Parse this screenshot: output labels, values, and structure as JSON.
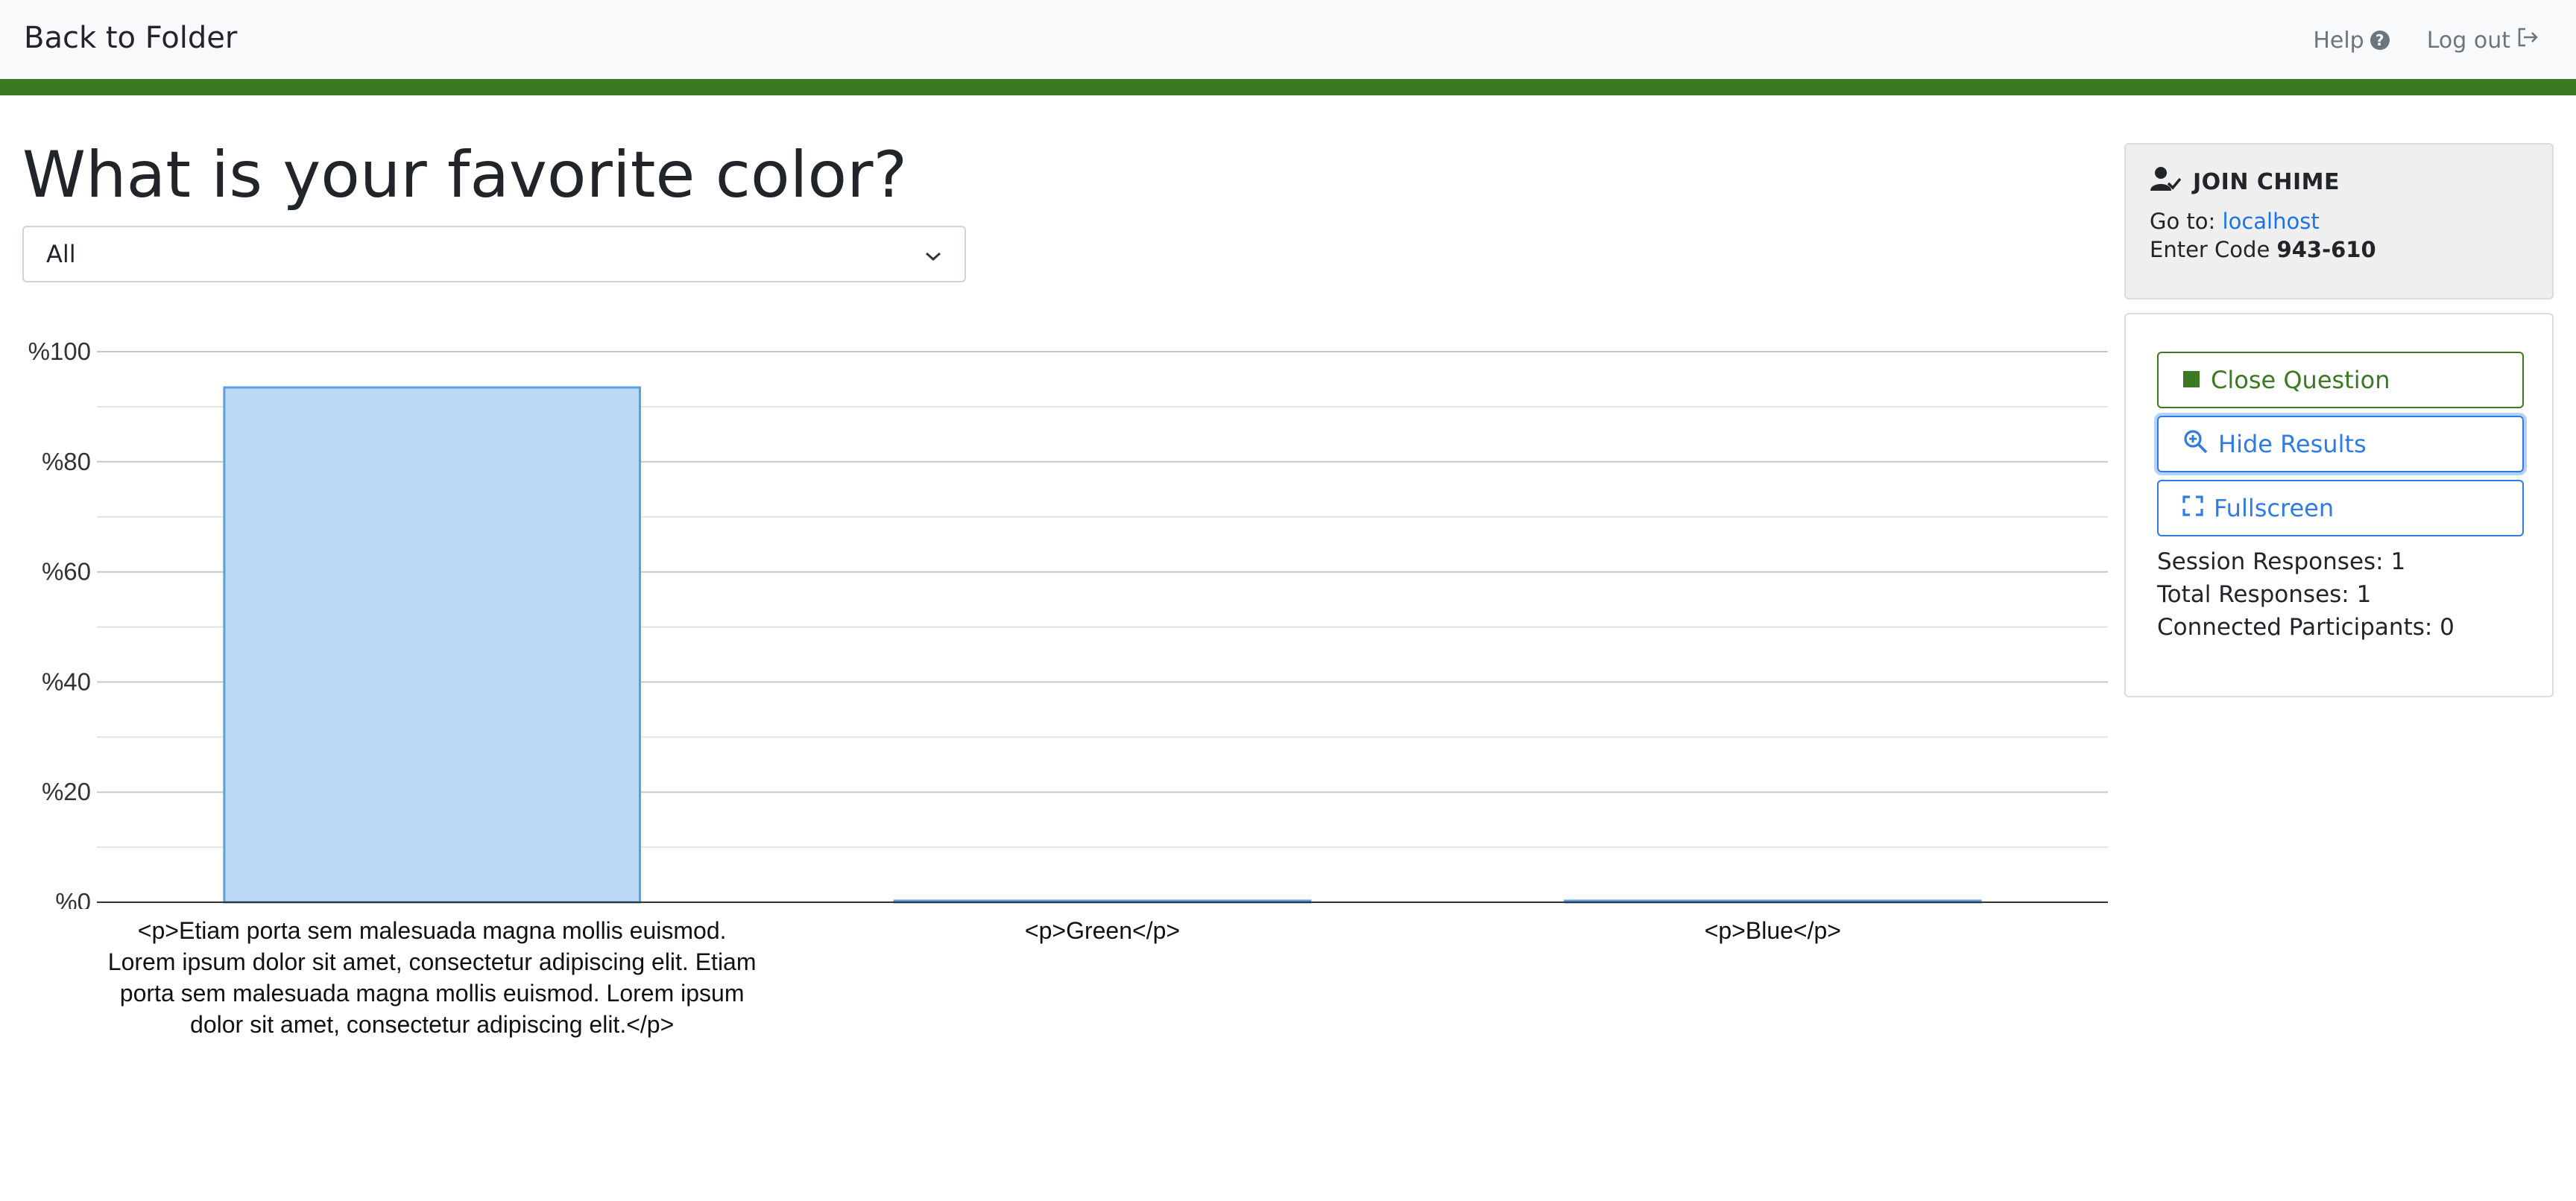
{
  "nav": {
    "back_label": "Back to Folder",
    "help_label": "Help",
    "help_icon_glyph": "?",
    "logout_label": "Log out"
  },
  "question": {
    "title": "What is your favorite color?",
    "filter_selected": "All"
  },
  "chart_data": {
    "type": "bar",
    "title": "",
    "xlabel": "",
    "ylabel": "",
    "ylim": [
      0,
      100
    ],
    "ytick_values": [
      0,
      20,
      40,
      60,
      80,
      100
    ],
    "ytick_labels": [
      "%0",
      "%20",
      "%40",
      "%60",
      "%80",
      "%100"
    ],
    "categories": [
      "<p>Etiam porta sem malesuada magna mollis euismod. Lorem ipsum dolor sit amet, consectetur adipiscing elit. Etiam porta sem malesuada magna mollis euismod. Lorem ipsum dolor sit amet, consectetur adipiscing elit.</p>",
      "<p>Green</p>",
      "<p>Blue</p>"
    ],
    "values": [
      93.5,
      0,
      0
    ],
    "grid": true,
    "bar_fill": "#bcdaf6",
    "bar_stroke": "#5b9fe3"
  },
  "join": {
    "heading": "JOIN CHIME",
    "goto_label": "Go to:",
    "goto_link": "localhost",
    "code_label": "Enter Code",
    "code_value": "943-610"
  },
  "controls": {
    "close_label": "Close Question",
    "hide_label": "Hide Results",
    "fullscreen_label": "Fullscreen",
    "session_responses": "Session Responses: 1",
    "total_responses": "Total Responses: 1",
    "connected_participants": "Connected Participants: 0"
  },
  "colors": {
    "brand_green": "#3b7a22",
    "link_blue": "#2e7be6",
    "topbar_bg": "#f8f9fa"
  }
}
